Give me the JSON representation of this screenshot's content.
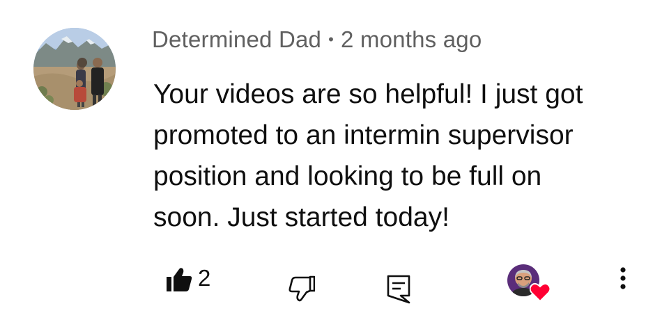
{
  "comment": {
    "author": "Determined Dad",
    "separator": "•",
    "timestamp": "2 months ago",
    "text": "Your videos are so helpful! I just got\npromoted to an intermin supervisor\nposition and looking to be full on\nsoon. Just started today!",
    "like_count": "2",
    "author_avatar": "family-photo-avatar",
    "creator_avatar": "creator-avatar"
  },
  "icons": {
    "like": "thumbs-up-icon",
    "dislike": "thumbs-down-icon",
    "reply": "reply-icon",
    "heart": "heart-icon",
    "more": "more-vertical-icon"
  },
  "colors": {
    "meta_text": "#606060",
    "body_text": "#0f0f0f",
    "heart": "#ff0033"
  }
}
